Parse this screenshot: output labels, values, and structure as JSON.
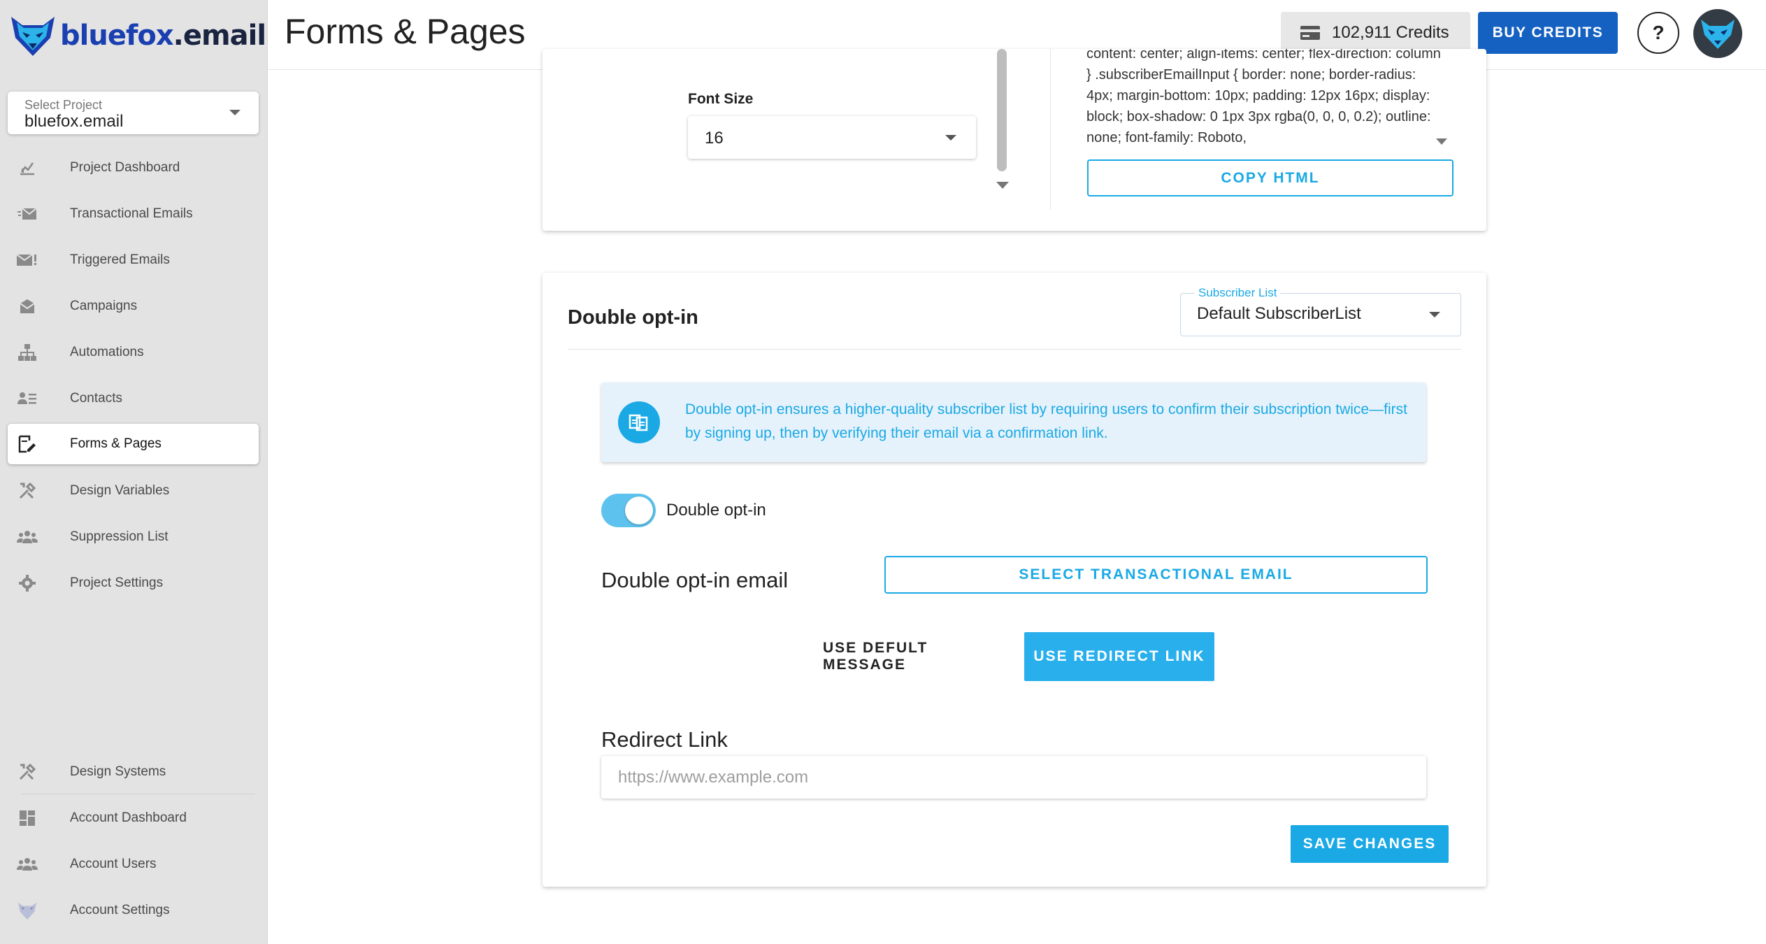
{
  "brand": {
    "name_main": "bluefox",
    "name_suffix": ".email",
    "color": "#1a3fb0"
  },
  "project_select": {
    "label": "Select Project",
    "value": "bluefox.email"
  },
  "sidebar": {
    "items": [
      {
        "label": "Project Dashboard",
        "icon": "chart-icon"
      },
      {
        "label": "Transactional Emails",
        "icon": "mail-fast-icon"
      },
      {
        "label": "Triggered Emails",
        "icon": "mail-alert-icon"
      },
      {
        "label": "Campaigns",
        "icon": "campaign-icon"
      },
      {
        "label": "Automations",
        "icon": "sitemap-icon"
      },
      {
        "label": "Contacts",
        "icon": "contacts-icon"
      },
      {
        "label": "Forms & Pages",
        "icon": "form-edit-icon",
        "active": true
      },
      {
        "label": "Design Variables",
        "icon": "tools-icon"
      },
      {
        "label": "Suppression List",
        "icon": "people-block-icon"
      },
      {
        "label": "Project Settings",
        "icon": "gear-icon"
      }
    ],
    "bottom_items": [
      {
        "label": "Design Systems",
        "icon": "tools-icon"
      },
      {
        "label": "Account Dashboard",
        "icon": "dashboard-icon"
      },
      {
        "label": "Account Users",
        "icon": "people-icon"
      },
      {
        "label": "Account Settings",
        "icon": "fox-icon"
      }
    ]
  },
  "header": {
    "title": "Forms & Pages",
    "credits": "102,911 Credits",
    "buy_label": "BUY CREDITS",
    "help_label": "?"
  },
  "style_panel": {
    "font_size_label": "Font Size",
    "font_size_value": "16",
    "code_text": "content: center; align-items: center; flex-direction: column } .subscriberEmailInput { border: none; border-radius: 4px; margin-bottom: 10px; padding: 12px 16px; display: block; box-shadow: 0 1px 3px rgba(0, 0, 0, 0.2); outline: none; font-family: Roboto,",
    "copy_label": "COPY HTML"
  },
  "double_optin": {
    "title": "Double opt-in",
    "subscriber_list_label": "Subscriber List",
    "subscriber_list_value": "Default SubscriberList",
    "info_text": "Double opt-in ensures a higher-quality subscriber list by requiring users to confirm their subscription twice—first by signing up, then by verifying their email via a confirmation link.",
    "toggle_label": "Double opt-in",
    "toggle_on": true,
    "email_label": "Double opt-in email",
    "select_email_label": "SELECT TRANSACTIONAL EMAIL",
    "default_message_label": "USE DEFULT MESSAGE",
    "redirect_link_label_btn": "USE REDIRECT LINK",
    "redirect_label": "Redirect Link",
    "redirect_placeholder": "https://www.example.com",
    "redirect_value": "",
    "save_label": "SAVE CHANGES"
  },
  "colors": {
    "accent": "#1aa9e5",
    "primary_button": "#1561c2",
    "info_bg": "#e6f2fb"
  }
}
